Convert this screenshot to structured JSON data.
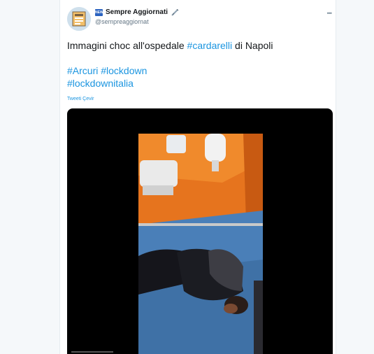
{
  "account": {
    "display_name": "Sempre Aggiornati",
    "handle": "@sempreaggiornat",
    "badge_text": "NEW",
    "verified_emoji": "syringe-icon"
  },
  "tweet": {
    "text_prefix": "Immagini choc all'ospedale ",
    "hashtag_inline": "#cardarelli",
    "text_suffix": " di Napoli",
    "hashtags_line1": "#Arcuri #lockdown",
    "hashtags_line2": "#lockdownitalia",
    "translate_label": "Tweeti Çevir"
  },
  "colors": {
    "link": "#1b95e0",
    "wall": "#e8701c",
    "floor": "#4a7fb8"
  }
}
